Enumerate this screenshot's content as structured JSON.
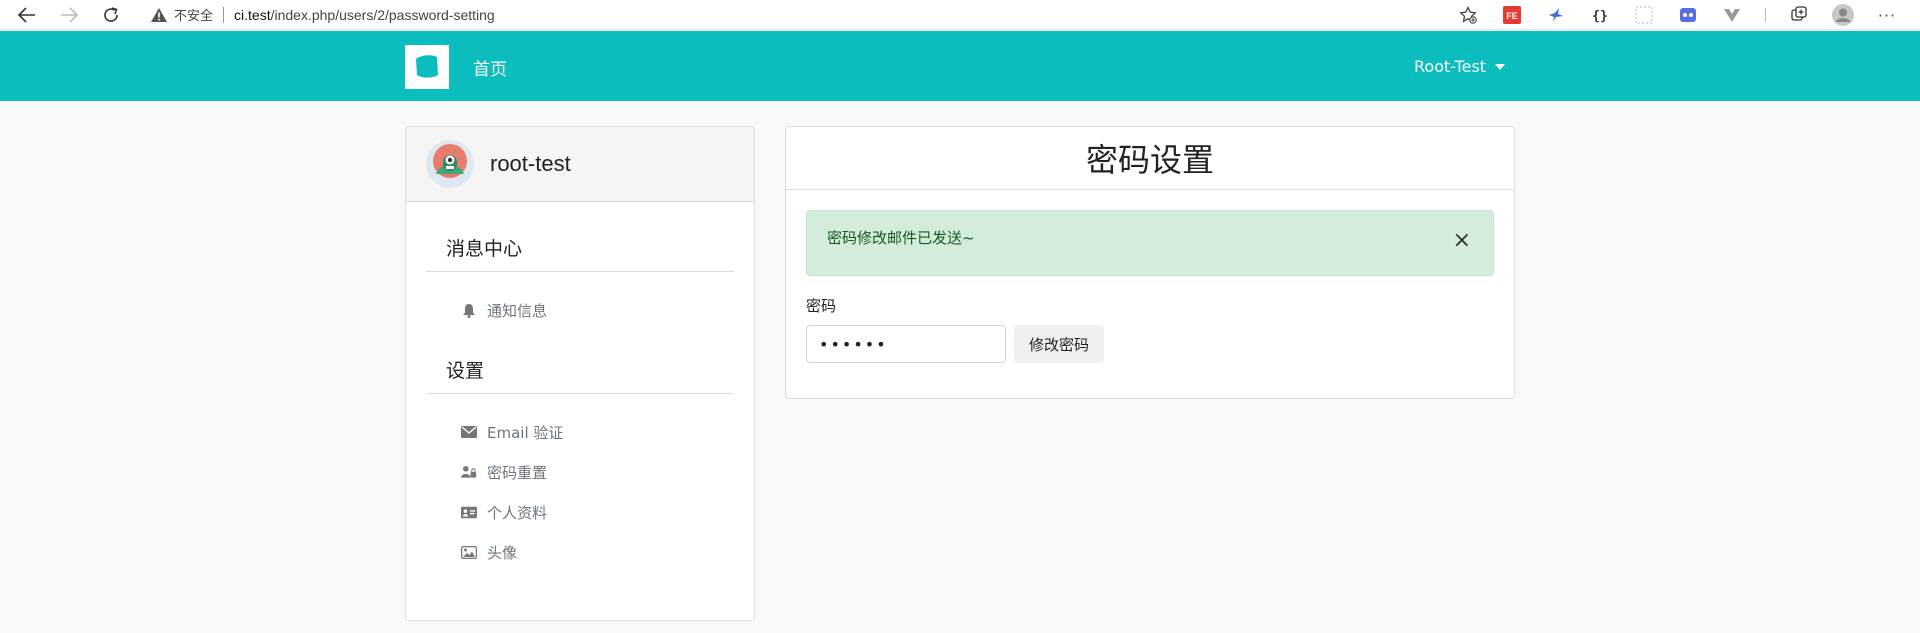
{
  "browser": {
    "security_label": "不安全",
    "url_host": "ci.test",
    "url_path": "/index.php/users/2/password-setting",
    "more_label": "···"
  },
  "navbar": {
    "home_label": "首页",
    "user_label": "Root-Test",
    "brand_color": "#0cbdbd"
  },
  "sidebar": {
    "username": "root-test",
    "sections": [
      {
        "title": "消息中心",
        "items": [
          {
            "label": "通知信息",
            "icon": "bell-icon"
          }
        ]
      },
      {
        "title": "设置",
        "items": [
          {
            "label": "Email 验证",
            "icon": "envelope-icon"
          },
          {
            "label": "密码重置",
            "icon": "user-lock-icon"
          },
          {
            "label": "个人资料",
            "icon": "id-card-icon"
          },
          {
            "label": "头像",
            "icon": "image-icon"
          }
        ]
      }
    ]
  },
  "main": {
    "title": "密码设置",
    "alert_text": "密码修改邮件已发送~",
    "alert_close": "×",
    "password_label": "密码",
    "password_value": "••••••",
    "submit_label": "修改密码",
    "alert_bg": "#d4edda"
  }
}
